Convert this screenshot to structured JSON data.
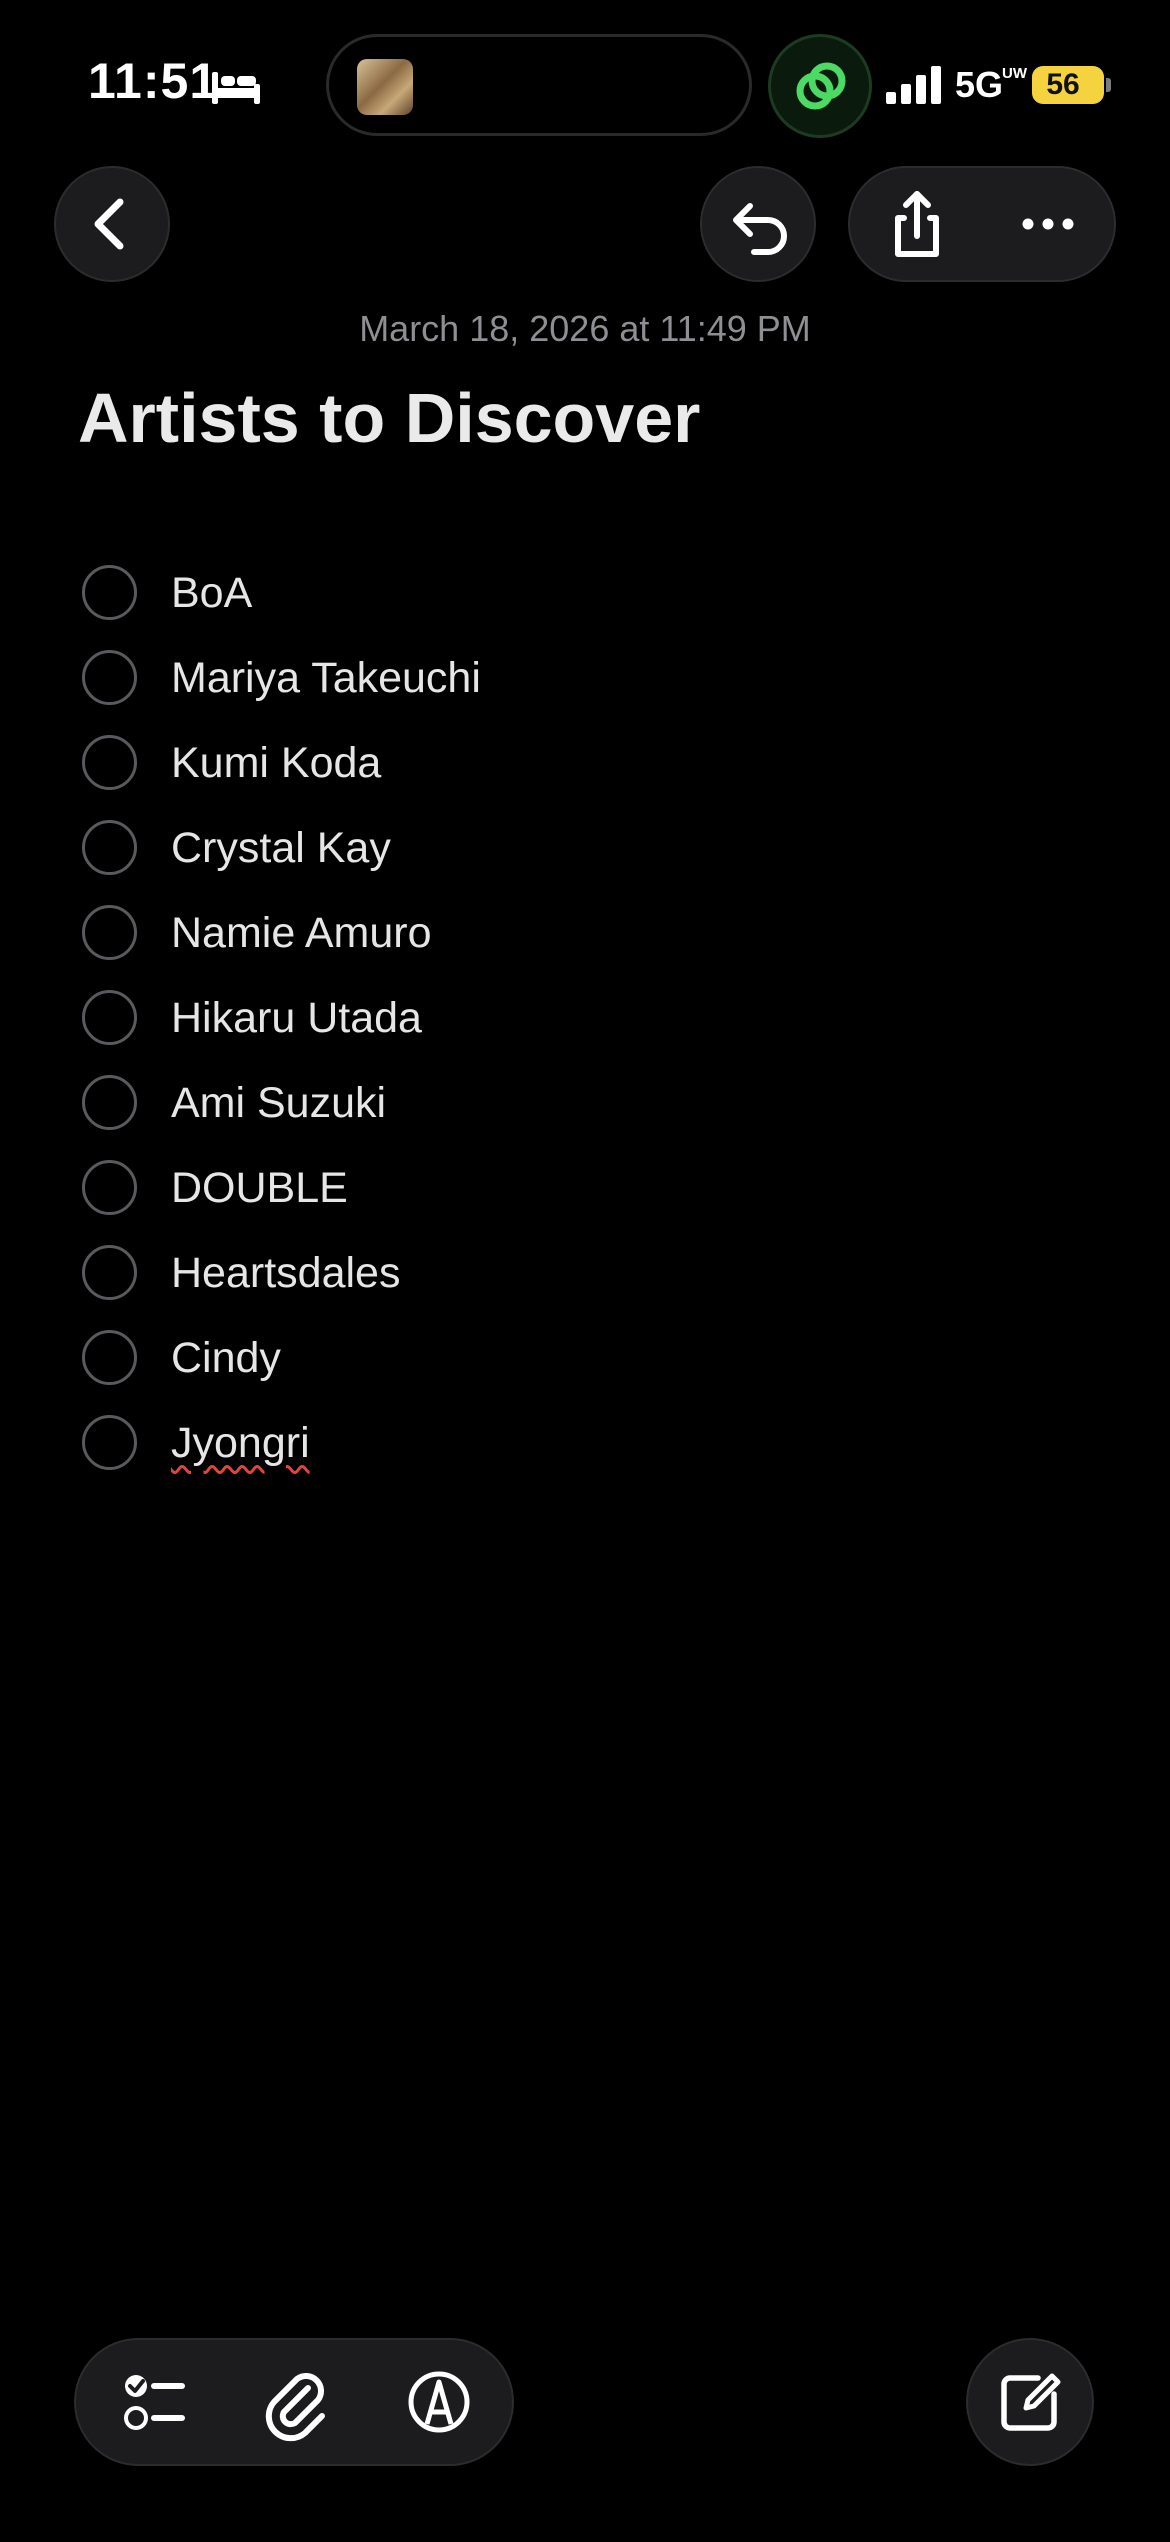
{
  "status_bar": {
    "time": "11:51",
    "network": "5G",
    "network_sub": "UW",
    "battery": "56",
    "icons": [
      "bed-icon",
      "now-playing-art",
      "activity-link-icon",
      "signal-bars-icon",
      "battery-charging-icon"
    ]
  },
  "nav": {
    "icons": [
      "chevron-left-icon",
      "undo-icon",
      "share-icon",
      "more-icon"
    ]
  },
  "note": {
    "date": "March 18, 2026 at 11:49 PM",
    "title": "Artists to Discover",
    "items": [
      {
        "label": "BoA",
        "checked": false
      },
      {
        "label": "Mariya Takeuchi",
        "checked": false
      },
      {
        "label": "Kumi Koda",
        "checked": false
      },
      {
        "label": "Crystal Kay",
        "checked": false
      },
      {
        "label": "Namie Amuro",
        "checked": false
      },
      {
        "label": "Hikaru Utada",
        "checked": false
      },
      {
        "label": "Ami Suzuki",
        "checked": false
      },
      {
        "label": "DOUBLE",
        "checked": false
      },
      {
        "label": "Heartsdales",
        "checked": false
      },
      {
        "label": "Cindy",
        "checked": false
      },
      {
        "label": "Jyongri",
        "checked": false,
        "spellcheck_flagged": true
      }
    ]
  },
  "toolbar": {
    "icons": [
      "checklist-icon",
      "paperclip-icon",
      "markup-icon",
      "compose-icon"
    ]
  },
  "colors": {
    "background": "#000000",
    "button_fill": "#1c1c1e",
    "text": "#e6e6e6",
    "date_text": "#8e8e93",
    "battery": "#f5d33e",
    "activity_green": "#4cd964",
    "spellcheck": "#e0463c"
  }
}
